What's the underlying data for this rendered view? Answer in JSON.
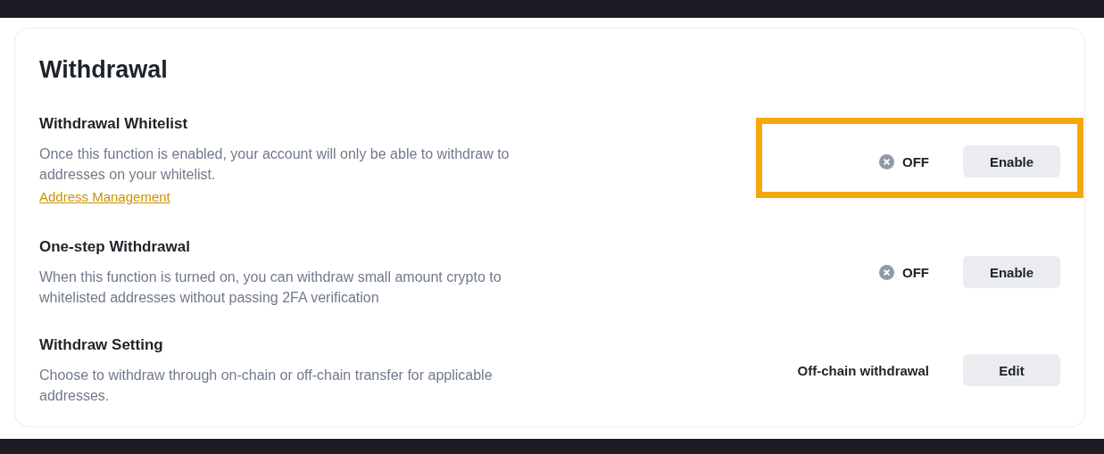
{
  "panel": {
    "title": "Withdrawal",
    "settings": [
      {
        "title": "Withdrawal Whitelist",
        "description": "Once this function is enabled, your account will only be able to withdraw to addresses on your whitelist.",
        "link": "Address Management",
        "kind": "toggle",
        "on": false,
        "status": "OFF",
        "button": "Enable",
        "highlighted": true
      },
      {
        "title": "One-step Withdrawal",
        "description": "When this function is turned on, you can withdraw small amount crypto to whitelisted addresses without passing 2FA verification",
        "kind": "toggle",
        "on": false,
        "status": "OFF",
        "button": "Enable",
        "highlighted": false
      },
      {
        "title": "Withdraw Setting",
        "description": "Choose to withdraw through on-chain or off-chain transfer for applicable addresses.",
        "kind": "value",
        "value": "Off-chain withdrawal",
        "button": "Edit",
        "highlighted": false
      }
    ]
  }
}
